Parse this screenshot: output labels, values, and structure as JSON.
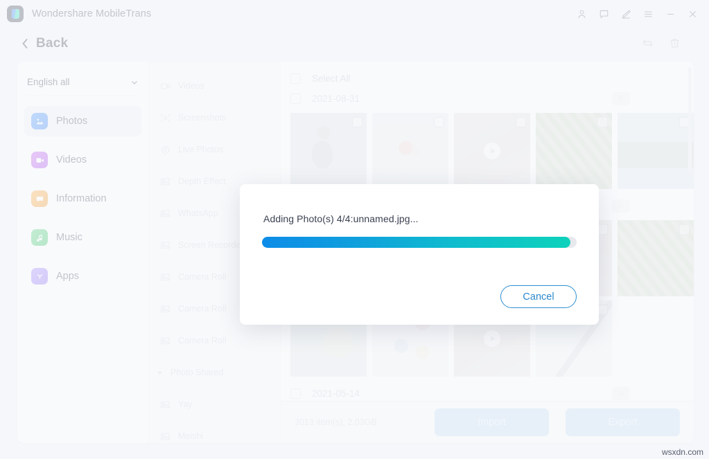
{
  "window": {
    "app_title": "Wondershare MobileTrans",
    "logo_icon": "mobiletrans-logo-icon",
    "controls": [
      {
        "name": "account-icon",
        "glyph": "person"
      },
      {
        "name": "feedback-icon",
        "glyph": "chat"
      },
      {
        "name": "edit-icon",
        "glyph": "pen"
      },
      {
        "name": "menu-icon",
        "glyph": "hamburger"
      },
      {
        "name": "minimize-icon",
        "glyph": "minimize"
      },
      {
        "name": "close-icon",
        "glyph": "close"
      }
    ]
  },
  "backbar": {
    "back_label": "Back",
    "chevron_icon": "chevron-left-icon",
    "tools": [
      {
        "name": "refresh-icon",
        "label": "Refresh"
      },
      {
        "name": "trash-icon",
        "label": "Delete"
      }
    ]
  },
  "sidebar": {
    "language": {
      "label": "English all",
      "chevron_icon": "chevron-down-icon"
    },
    "items": [
      {
        "label": "Photos",
        "icon": "photos-icon",
        "active": true
      },
      {
        "label": "Videos",
        "icon": "videos-icon",
        "active": false
      },
      {
        "label": "Information",
        "icon": "information-icon",
        "active": false
      },
      {
        "label": "Music",
        "icon": "music-icon",
        "active": false
      },
      {
        "label": "Apps",
        "icon": "apps-icon",
        "active": false
      }
    ]
  },
  "categories": [
    {
      "label": "Videos",
      "icon": "video-camera-icon",
      "type": "item"
    },
    {
      "label": "Screenshots",
      "icon": "screenshot-icon",
      "type": "item"
    },
    {
      "label": "Live Photos",
      "icon": "live-photo-icon",
      "type": "item"
    },
    {
      "label": "Depth Effect",
      "icon": "photo-icon",
      "type": "item"
    },
    {
      "label": "WhatsApp",
      "icon": "photo-icon",
      "type": "item"
    },
    {
      "label": "Screen Recorder",
      "icon": "photo-icon",
      "type": "item"
    },
    {
      "label": "Camera Roll",
      "icon": "photo-icon",
      "type": "item"
    },
    {
      "label": "Camera Roll",
      "icon": "photo-icon",
      "type": "item"
    },
    {
      "label": "Camera Roll",
      "icon": "photo-icon",
      "type": "item"
    },
    {
      "label": "Photo Shared",
      "icon": "caret-down-icon",
      "type": "group"
    },
    {
      "label": "Yay",
      "icon": "photo-icon",
      "type": "item"
    },
    {
      "label": "Meishi",
      "icon": "photo-icon",
      "type": "item"
    }
  ],
  "content": {
    "select_all_label": "Select All",
    "groups": [
      {
        "date": "2021-08-31",
        "count": "5"
      },
      {
        "date": "",
        "count": "9"
      },
      {
        "date": "2021-05-14",
        "count": "3"
      }
    ],
    "row1_thumbs": [
      {
        "name": "thumbnail-person",
        "kind": "photo"
      },
      {
        "name": "thumbnail-flowers",
        "kind": "photo"
      },
      {
        "name": "thumbnail-video",
        "kind": "video"
      },
      {
        "name": "thumbnail-leaves",
        "kind": "photo"
      },
      {
        "name": "thumbnail-palms",
        "kind": "photo"
      }
    ],
    "row2_thumbs": [
      {
        "name": "thumbnail-house",
        "kind": "photo"
      },
      {
        "name": "thumbnail-leaves-2",
        "kind": "photo"
      }
    ],
    "row3_thumbs": [
      {
        "name": "thumbnail-tree",
        "kind": "photo"
      },
      {
        "name": "thumbnail-chart",
        "kind": "photo"
      },
      {
        "name": "thumbnail-video-2",
        "kind": "video"
      },
      {
        "name": "thumbnail-cable",
        "kind": "photo"
      }
    ]
  },
  "bottombar": {
    "stats": "3013 item(s), 2.03GB",
    "import_label": "Import",
    "export_label": "Export"
  },
  "modal": {
    "status_text": "Adding Photo(s) 4/4:unnamed.jpg...",
    "progress_percent": 98,
    "cancel_label": "Cancel",
    "progress_start_color": "#0d8ce8",
    "progress_end_color": "#0dd2bb",
    "accent_color": "#2b88cc"
  },
  "watermark": "wsxdn.com"
}
